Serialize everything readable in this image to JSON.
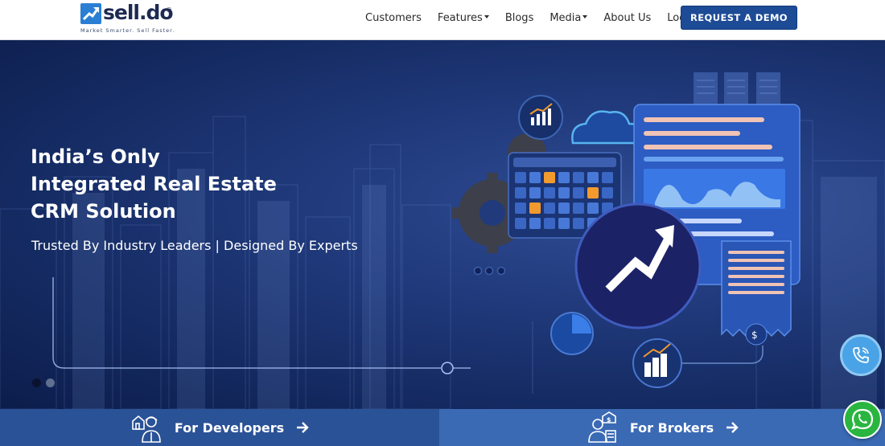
{
  "brand": {
    "name": "sell.do",
    "registered": "®",
    "tagline": "Market Smarter. Sell Faster."
  },
  "nav": {
    "items": [
      {
        "label": "Customers",
        "has_dropdown": false
      },
      {
        "label": "Features",
        "has_dropdown": true
      },
      {
        "label": "Blogs",
        "has_dropdown": false
      },
      {
        "label": "Media",
        "has_dropdown": true
      },
      {
        "label": "About Us",
        "has_dropdown": false
      },
      {
        "label": "Login",
        "has_dropdown": false
      }
    ],
    "cta_label": "REQUEST A DEMO"
  },
  "hero": {
    "title_lines": [
      "India’s Only",
      "Integrated Real Estate",
      "CRM Solution"
    ],
    "subtitle": "Trusted By Industry Leaders | Designed By Experts",
    "slide_count": 2,
    "active_slide": 1
  },
  "bottom": {
    "developers_label": "For Developers",
    "brokers_label": "For Brokers"
  },
  "icons": {
    "logo": "rising-arrow-logo-icon",
    "call": "phone-call-icon",
    "whatsapp": "whatsapp-icon",
    "developers": "developer-person-icon",
    "brokers": "broker-person-icon",
    "arrow": "arrow-right-icon"
  },
  "colors": {
    "primary": "#1d4b96",
    "developers_bg": "#2a5296",
    "brokers_bg": "#3b6ab5",
    "call_bg": "#4aa3e6",
    "whatsapp_bg": "#2ab540",
    "hero_bg": "#203a7c"
  }
}
